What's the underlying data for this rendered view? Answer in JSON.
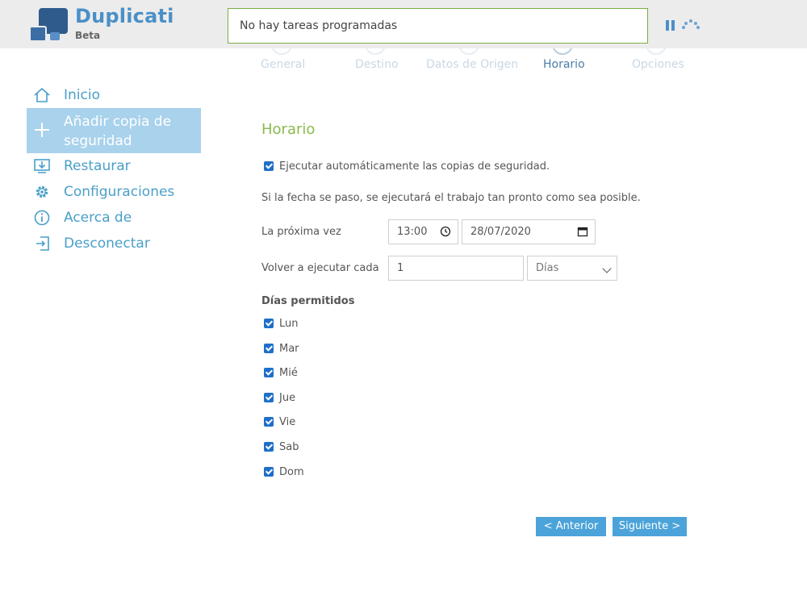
{
  "app": {
    "name": "Duplicati",
    "channel": "Beta",
    "status": "No hay tareas programadas"
  },
  "steps": [
    {
      "label": "General",
      "active": false
    },
    {
      "label": "Destino",
      "active": false
    },
    {
      "label": "Datos de Origen",
      "active": false
    },
    {
      "label": "Horario",
      "active": true
    },
    {
      "label": "Opciones",
      "active": false
    }
  ],
  "sidebar": {
    "items": [
      {
        "label": "Inicio",
        "icon": "home-icon"
      },
      {
        "label": "Añadir copia de seguridad",
        "line1": "Añadir copia de",
        "line2": "seguridad",
        "icon": "plus-icon",
        "active": true
      },
      {
        "label": "Restaurar",
        "icon": "restore-icon"
      },
      {
        "label": "Configuraciones",
        "icon": "gear-icon"
      },
      {
        "label": "Acerca de",
        "icon": "info-icon"
      },
      {
        "label": "Desconectar",
        "icon": "logout-icon"
      }
    ]
  },
  "schedule": {
    "title": "Horario",
    "auto_run_label": "Ejecutar automáticamente las copias de seguridad.",
    "auto_run_checked": true,
    "note": "Si la fecha se paso, se ejecutará el trabajo tan pronto como sea posible.",
    "next_time_label": "La próxima vez",
    "time_value": "13:00",
    "date_value": "28/07/2020",
    "repeat_label": "Volver a ejecutar cada",
    "repeat_value": "1",
    "repeat_unit": "Días",
    "allowed_days_label": "Días permitidos",
    "days": [
      {
        "label": "Lun",
        "checked": true
      },
      {
        "label": "Mar",
        "checked": true
      },
      {
        "label": "Mié",
        "checked": true
      },
      {
        "label": "Jue",
        "checked": true
      },
      {
        "label": "Vie",
        "checked": true
      },
      {
        "label": "Sab",
        "checked": true
      },
      {
        "label": "Dom",
        "checked": true
      }
    ]
  },
  "buttons": {
    "previous": "< Anterior",
    "next": "Siguiente >"
  },
  "colors": {
    "accent": "#4ba3d9",
    "title_green": "#8bba4f",
    "nav_blue": "#4a9fc9",
    "active_nav": "#a9d2ec",
    "checkbox": "#1f6fc8"
  }
}
